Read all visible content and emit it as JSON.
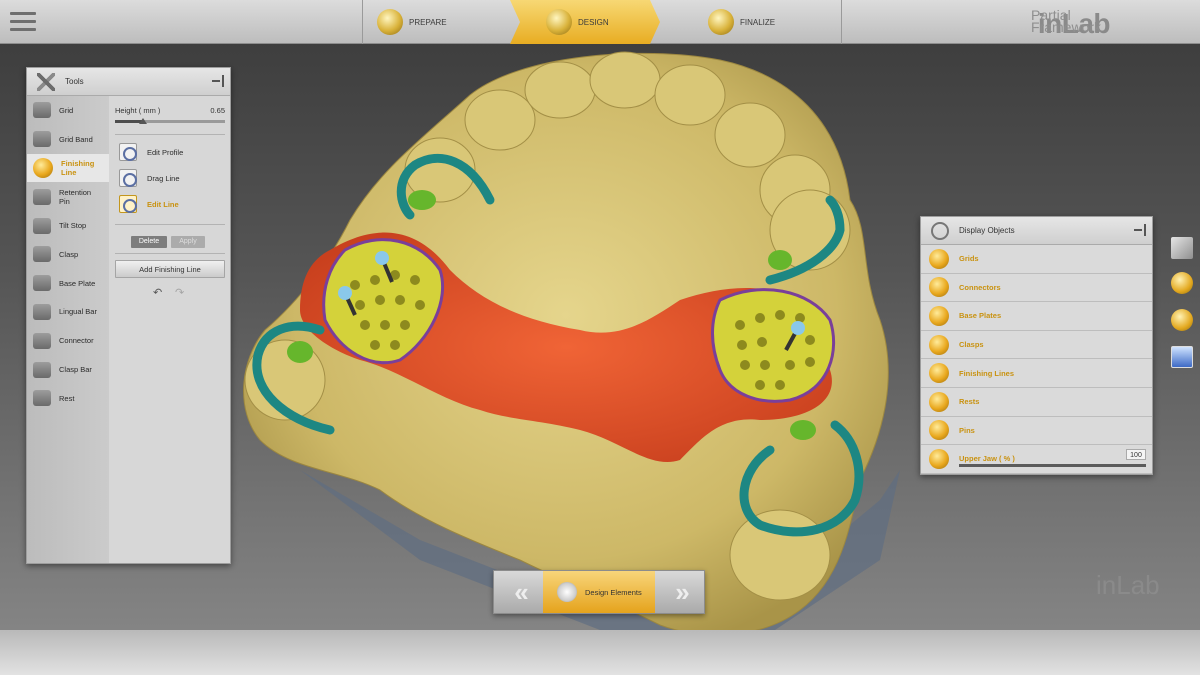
{
  "header": {
    "steps": [
      {
        "label": "PREPARE",
        "icon": "prepare-icon",
        "active": false
      },
      {
        "label": "DESIGN",
        "icon": "design-icon",
        "active": true
      },
      {
        "label": "FINALIZE",
        "icon": "finalize-icon",
        "active": false
      }
    ],
    "brand": "inLab",
    "brand_sub_line1": "Partial",
    "brand_sub_line2": "Framework"
  },
  "tools_panel": {
    "title": "Tools",
    "items": [
      {
        "label": "Grid",
        "icon": "grid-icon"
      },
      {
        "label": "Grid Band",
        "icon": "grid-band-icon"
      },
      {
        "label": "Finishing Line",
        "icon": "finishing-line-icon",
        "active": true
      },
      {
        "label": "Retention Pin",
        "icon": "retention-pin-icon"
      },
      {
        "label": "Tilt Stop",
        "icon": "tilt-stop-icon"
      },
      {
        "label": "Clasp",
        "icon": "clasp-icon"
      },
      {
        "label": "Base Plate",
        "icon": "base-plate-icon"
      },
      {
        "label": "Lingual Bar",
        "icon": "lingual-bar-icon"
      },
      {
        "label": "Connector",
        "icon": "connector-icon"
      },
      {
        "label": "Clasp Bar",
        "icon": "clasp-bar-icon"
      },
      {
        "label": "Rest",
        "icon": "rest-icon"
      }
    ],
    "options": {
      "height_label": "Height  ( mm )",
      "height_value": "0.65",
      "height_fraction": 0.25,
      "edit_profile": "Edit Profile",
      "drag_line": "Drag Line",
      "edit_line": "Edit Line",
      "delete": "Delete",
      "apply": "Apply",
      "add_finishing_line": "Add Finishing Line",
      "undo": "↶",
      "redo": "↷"
    }
  },
  "display_objects": {
    "title": "Display Objects",
    "items": [
      {
        "label": "Grids",
        "icon": "grids-icon"
      },
      {
        "label": "Connectors",
        "icon": "connectors-icon"
      },
      {
        "label": "Base Plates",
        "icon": "base-plates-icon"
      },
      {
        "label": "Clasps",
        "icon": "clasps-icon"
      },
      {
        "label": "Finishing Lines",
        "icon": "finishing-lines-icon"
      },
      {
        "label": "Rests",
        "icon": "rests-icon"
      },
      {
        "label": "Pins",
        "icon": "pins-icon"
      }
    ],
    "upper_jaw_label": "Upper Jaw  ( % )",
    "upper_jaw_value": "100"
  },
  "bottom_nav": {
    "prev": "«",
    "center": "Design Elements",
    "next": "»"
  },
  "watermark": "inLab",
  "colors": {
    "accent": "#e8ad22",
    "stone": "#d8c67a",
    "framework": "#e5532c",
    "mesh": "#d6d33a",
    "clasp": "#1f8a86",
    "rest": "#6fbf2f"
  }
}
